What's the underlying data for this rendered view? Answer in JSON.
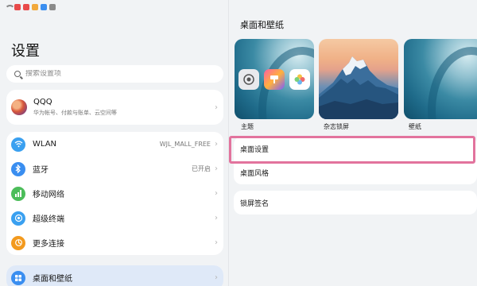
{
  "left": {
    "title": "设置",
    "search": {
      "placeholder": "搜索设置项"
    },
    "account": {
      "name": "QQQ",
      "subtitle": "华为帐号、付款与账单、云空间等"
    },
    "network_items": [
      {
        "label": "WLAN",
        "value": "WJL_MALL_FREE",
        "icon": "wifi-icon",
        "color": "#3aa0f0"
      },
      {
        "label": "蓝牙",
        "value": "已开启",
        "icon": "bluetooth-icon",
        "color": "#3a8ef0"
      },
      {
        "label": "移动网络",
        "value": "",
        "icon": "mobile-network-icon",
        "color": "#4cbd5a"
      },
      {
        "label": "超级终端",
        "value": "",
        "icon": "super-device-icon",
        "color": "#3aa0f0"
      },
      {
        "label": "更多连接",
        "value": "",
        "icon": "more-connections-icon",
        "color": "#f39a1e"
      }
    ],
    "selected_item": {
      "label": "桌面和壁纸",
      "icon": "desktop-wallpaper-icon",
      "color": "#3a8ef0"
    }
  },
  "right": {
    "title": "桌面和壁纸",
    "thumbnails": [
      {
        "label": "主题"
      },
      {
        "label": "杂志锁屏"
      },
      {
        "label": "壁纸"
      }
    ],
    "rows": [
      {
        "label": "桌面设置"
      },
      {
        "label": "桌面风格"
      }
    ],
    "lock_row": {
      "label": "锁屏签名"
    }
  },
  "colors": {
    "highlight": "#e2739d",
    "selected_bg": "#dfe9f8",
    "accent": "#3a8ef0"
  }
}
